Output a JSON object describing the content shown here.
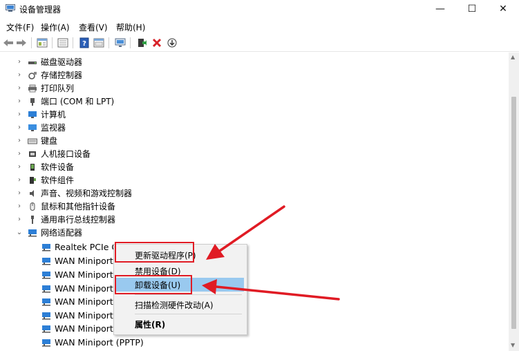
{
  "window": {
    "title": "设备管理器",
    "controls": {
      "minimize": "—",
      "maximize": "☐",
      "close": "✕"
    }
  },
  "menu": [
    "文件(F)",
    "操作(A)",
    "查看(V)",
    "帮助(H)"
  ],
  "toolbar": {
    "icons": [
      "back-arrow-icon",
      "forward-arrow-icon",
      "properties-icon",
      "list-icon",
      "help-icon",
      "view-icon",
      "monitor-icon",
      "update-driver-icon",
      "uninstall-x-icon",
      "download-icon"
    ]
  },
  "tree": {
    "categories": [
      {
        "label": "磁盘驱动器",
        "icon": "disk-drive-icon",
        "expanded": false
      },
      {
        "label": "存储控制器",
        "icon": "storage-controller-icon",
        "expanded": false
      },
      {
        "label": "打印队列",
        "icon": "printer-icon",
        "expanded": false
      },
      {
        "label": "端口 (COM 和 LPT)",
        "icon": "port-icon",
        "expanded": false
      },
      {
        "label": "计算机",
        "icon": "computer-icon",
        "expanded": false
      },
      {
        "label": "监视器",
        "icon": "monitor-icon",
        "expanded": false
      },
      {
        "label": "键盘",
        "icon": "keyboard-icon",
        "expanded": false
      },
      {
        "label": "人机接口设备",
        "icon": "hid-icon",
        "expanded": false
      },
      {
        "label": "软件设备",
        "icon": "software-device-icon",
        "expanded": false
      },
      {
        "label": "软件组件",
        "icon": "software-component-icon",
        "expanded": false
      },
      {
        "label": "声音、视频和游戏控制器",
        "icon": "speaker-icon",
        "expanded": false
      },
      {
        "label": "鼠标和其他指针设备",
        "icon": "mouse-icon",
        "expanded": false
      },
      {
        "label": "通用串行总线控制器",
        "icon": "usb-icon",
        "expanded": false
      },
      {
        "label": "网络适配器",
        "icon": "network-adapter-icon",
        "expanded": true
      }
    ],
    "network_children": [
      "Realtek PCIe G",
      "WAN Miniport",
      "WAN Miniport",
      "WAN Miniport",
      "WAN Miniport",
      "WAN Miniport",
      "WAN Miniport",
      "WAN Miniport (PPTP)"
    ]
  },
  "context_menu": {
    "items": [
      {
        "label": "更新驱动程序(P)",
        "bold": false,
        "highlighted": false
      },
      {
        "label": "禁用设备(D)",
        "bold": false,
        "highlighted": false
      },
      {
        "label": "卸载设备(U)",
        "bold": false,
        "highlighted": true
      },
      {
        "label": "扫描检测硬件改动(A)",
        "bold": false,
        "highlighted": false
      },
      {
        "label": "属性(R)",
        "bold": true,
        "highlighted": false
      }
    ]
  },
  "colors": {
    "highlight": "#99c9ef",
    "annotation": "#e01b24",
    "device_blue": "#1e7fd8"
  }
}
